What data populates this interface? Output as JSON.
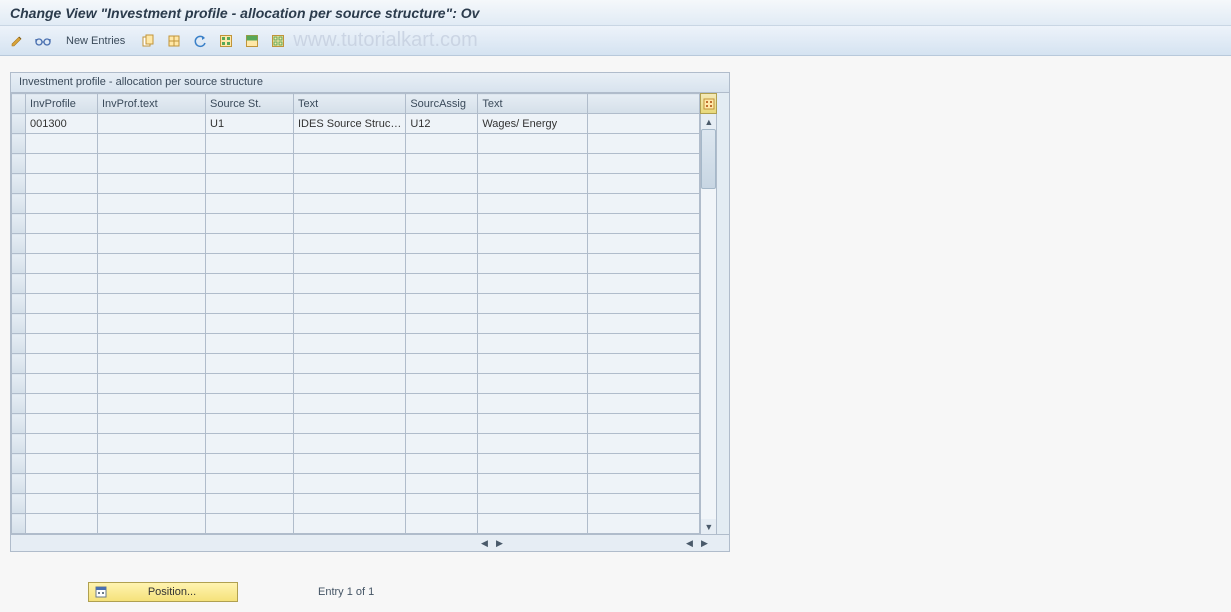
{
  "title": "Change View \"Investment profile - allocation per source structure\": Ov",
  "toolbar": {
    "new_entries": "New Entries"
  },
  "watermark": "www.tutorialkart.com",
  "panel": {
    "title": "Investment profile - allocation per source structure"
  },
  "columns": {
    "inv_profile": "InvProfile",
    "inv_prof_text": "InvProf.text",
    "source_st": "Source St.",
    "text1": "Text",
    "sourc_assig": "SourcAssig",
    "text2": "Text"
  },
  "rows": [
    {
      "inv_profile": "001300",
      "inv_prof_text": "",
      "source_st": "U1",
      "text1": "IDES Source Struc…",
      "sourc_assig": "U12",
      "text2": "Wages/ Energy"
    }
  ],
  "footer": {
    "position": "Position...",
    "entry": "Entry 1 of 1"
  }
}
